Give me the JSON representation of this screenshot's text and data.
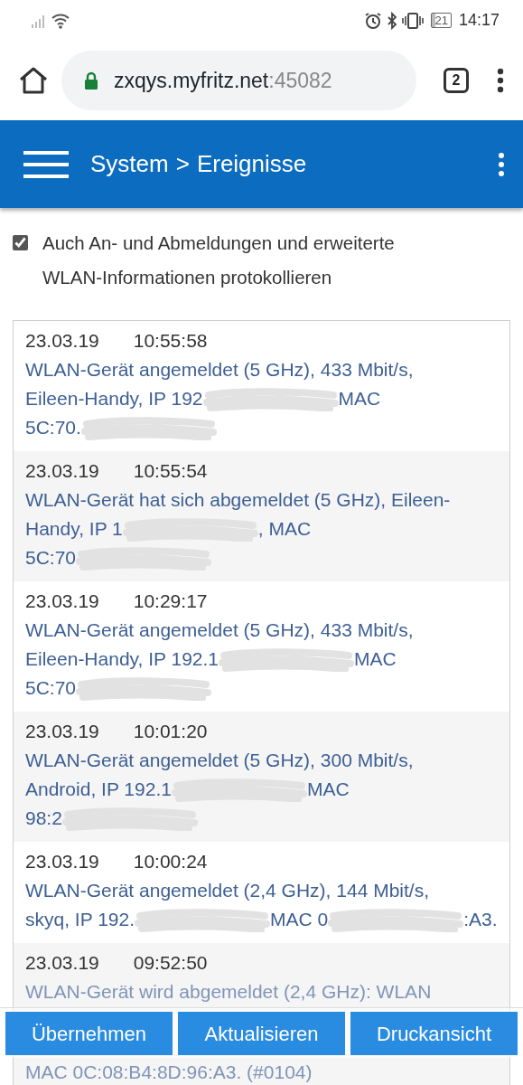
{
  "status_bar": {
    "battery": "21",
    "time": "14:17"
  },
  "browser": {
    "url_host": "zxqys.myfritz.net",
    "url_port": ":45082",
    "tab_count": "2"
  },
  "header": {
    "section": "System",
    "separator": ">",
    "page": "Ereignisse"
  },
  "log_option": {
    "label": "Auch An- und Abmeldungen und erweiterte WLAN-Informationen protokollieren",
    "checked": true
  },
  "events": [
    {
      "date": "23.03.19",
      "time": "10:55:58",
      "lines": [
        [
          {
            "kind": "text",
            "text": "WLAN-Gerät angemeldet (5 GHz), 433 Mbit/s,"
          }
        ],
        [
          {
            "kind": "text",
            "text": "Eileen-Handy, IP 192"
          },
          {
            "kind": "redaction"
          },
          {
            "kind": "text",
            "text": "MAC"
          }
        ],
        [
          {
            "kind": "text",
            "text": "5C:70."
          },
          {
            "kind": "redaction"
          }
        ]
      ]
    },
    {
      "date": "23.03.19",
      "time": "10:55:54",
      "lines": [
        [
          {
            "kind": "text",
            "text": "WLAN-Gerät hat sich abgemeldet (5 GHz), Eileen-"
          }
        ],
        [
          {
            "kind": "text",
            "text": "Handy, IP 1"
          },
          {
            "kind": "redaction"
          },
          {
            "kind": "text",
            "text": ", MAC"
          }
        ],
        [
          {
            "kind": "text",
            "text": "5C:70"
          },
          {
            "kind": "redaction"
          }
        ]
      ]
    },
    {
      "date": "23.03.19",
      "time": "10:29:17",
      "lines": [
        [
          {
            "kind": "text",
            "text": "WLAN-Gerät angemeldet (5 GHz), 433 Mbit/s,"
          }
        ],
        [
          {
            "kind": "text",
            "text": "Eileen-Handy, IP 192.1"
          },
          {
            "kind": "redaction"
          },
          {
            "kind": "text",
            "text": "MAC"
          }
        ],
        [
          {
            "kind": "text",
            "text": "5C:70"
          },
          {
            "kind": "redaction"
          }
        ]
      ]
    },
    {
      "date": "23.03.19",
      "time": "10:01:20",
      "lines": [
        [
          {
            "kind": "text",
            "text": "WLAN-Gerät angemeldet (5 GHz), 300 Mbit/s,"
          }
        ],
        [
          {
            "kind": "text",
            "text": "Android, IP 192.1"
          },
          {
            "kind": "redaction"
          },
          {
            "kind": "text",
            "text": "MAC"
          }
        ],
        [
          {
            "kind": "text",
            "text": "98:2"
          },
          {
            "kind": "redaction"
          }
        ]
      ]
    },
    {
      "date": "23.03.19",
      "time": "10:00:24",
      "lines": [
        [
          {
            "kind": "text",
            "text": "WLAN-Gerät angemeldet (2,4 GHz), 144 Mbit/s,"
          }
        ],
        [
          {
            "kind": "text",
            "text": "skyq, IP 192."
          },
          {
            "kind": "redaction"
          },
          {
            "kind": "text",
            "text": "MAC 0"
          },
          {
            "kind": "redaction"
          },
          {
            "kind": "text",
            "text": ":A3."
          }
        ]
      ]
    },
    {
      "date": "23.03.19",
      "time": "09:52:50",
      "lines": [
        [
          {
            "kind": "text",
            "text": "WLAN-Gerät wird abgemeldet (2,4 GHz): WLAN"
          }
        ],
        [
          {
            "kind": "text",
            "text": "MAC 0C:08:B4:8D:96:A3. (#0104)"
          }
        ]
      ]
    }
  ],
  "buttons": [
    "Übernehmen",
    "Aktualisieren",
    "Druckansicht"
  ]
}
